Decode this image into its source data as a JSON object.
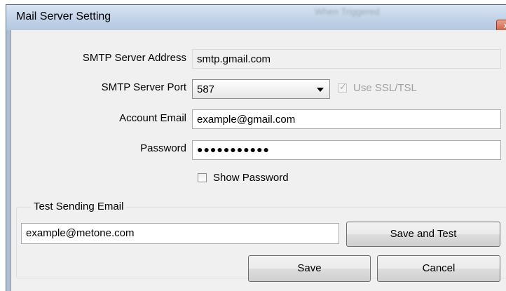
{
  "window": {
    "title": "Mail Server Setting",
    "background_text": "When Triggered",
    "close_glyph": "x"
  },
  "form": {
    "smtp_address_label": "SMTP Server Address",
    "smtp_address_value": "smtp.gmail.com",
    "smtp_port_label": "SMTP Server Port",
    "smtp_port_value": "587",
    "use_ssl_label": "Use SSL/TSL",
    "use_ssl_checked": true,
    "account_email_label": "Account Email",
    "account_email_value": "example@gmail.com",
    "password_label": "Password",
    "password_masked": "●●●●●●●●●●●",
    "show_password_label": "Show Password",
    "show_password_checked": false
  },
  "test_group": {
    "legend": "Test Sending Email",
    "email_value": "example@metone.com",
    "save_and_test_label": "Save and Test"
  },
  "footer": {
    "save_label": "Save",
    "cancel_label": "Cancel"
  },
  "colors": {
    "title_gradient_top": "#d8e4f2",
    "title_gradient_bottom": "#b5c8e0",
    "client_bg": "#f0f0f0",
    "close_button": "#c8553a"
  }
}
